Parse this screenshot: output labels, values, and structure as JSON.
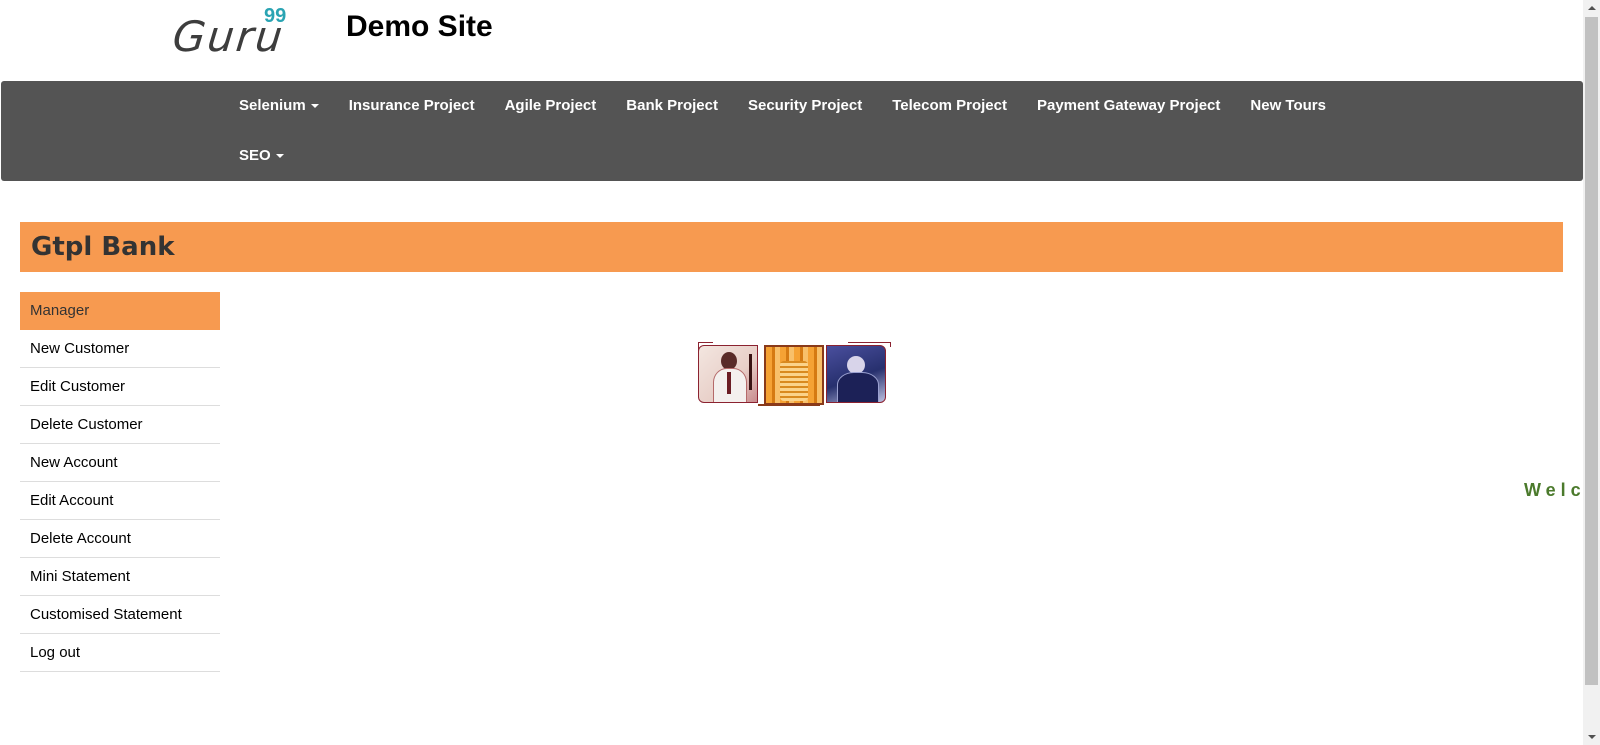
{
  "header": {
    "logo_text": "Guru",
    "logo_superscript": "99",
    "site_title": "Demo Site"
  },
  "navbar": {
    "row1": [
      {
        "label": "Selenium",
        "has_caret": true
      },
      {
        "label": "Insurance Project"
      },
      {
        "label": "Agile Project"
      },
      {
        "label": "Bank Project"
      },
      {
        "label": "Security Project"
      },
      {
        "label": "Telecom Project"
      },
      {
        "label": "Payment Gateway Project"
      },
      {
        "label": "New Tours"
      }
    ],
    "row2": [
      {
        "label": "SEO",
        "has_caret": true
      }
    ]
  },
  "bank": {
    "name": "Gtpl Bank"
  },
  "menu": {
    "items": [
      {
        "label": "Manager",
        "active": true
      },
      {
        "label": "New Customer"
      },
      {
        "label": "Edit Customer"
      },
      {
        "label": "Delete Customer"
      },
      {
        "label": "New Account"
      },
      {
        "label": "Edit Account"
      },
      {
        "label": "Delete Account"
      },
      {
        "label": "Mini Statement"
      },
      {
        "label": "Customised Statement"
      },
      {
        "label": "Log out"
      }
    ]
  },
  "main": {
    "welcome_text": "Welco"
  },
  "colors": {
    "navbar_bg": "#545454",
    "accent_orange": "#f79a50",
    "logo_teal": "#2aa4b3",
    "welcome_green": "#4b7a2c"
  }
}
